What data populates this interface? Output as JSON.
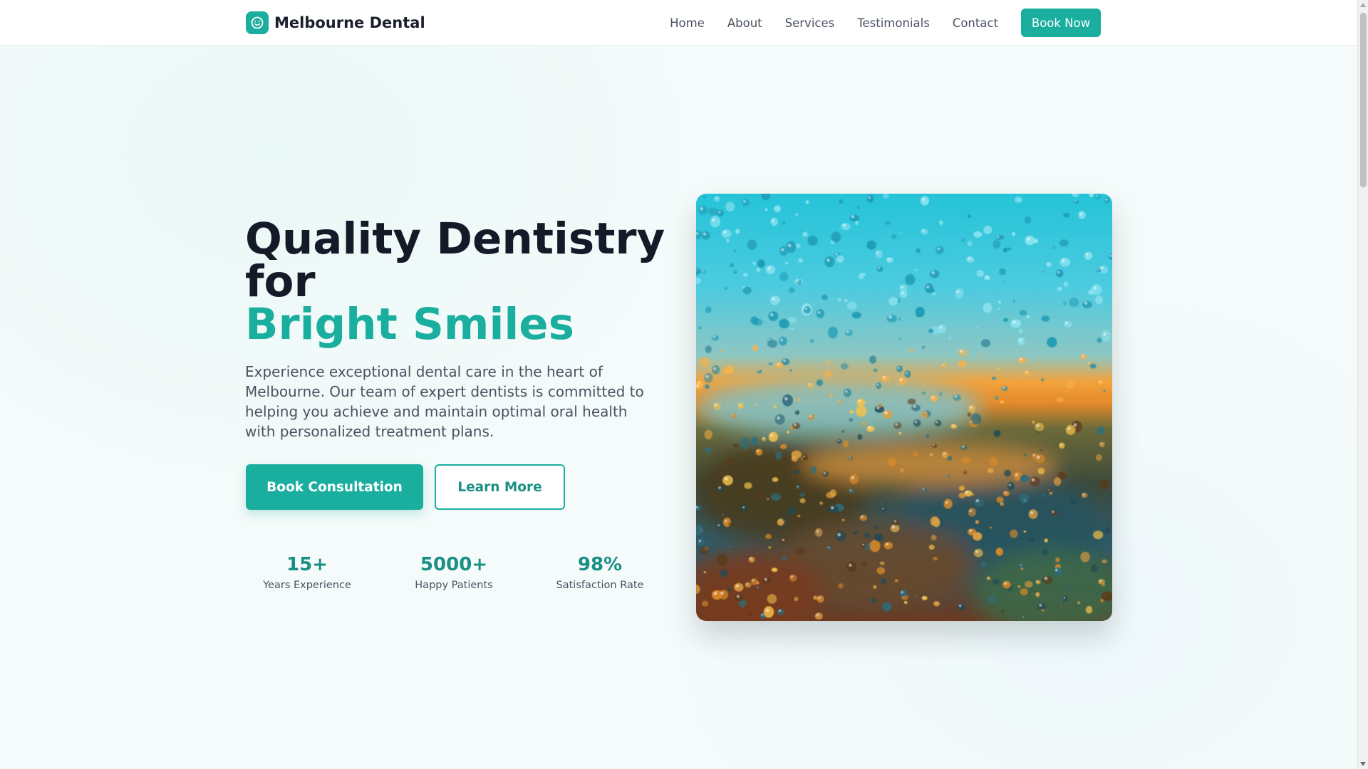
{
  "brand": {
    "name": "Melbourne Dental",
    "accent_color": "#1aae9f",
    "logo_icon": "smile-icon"
  },
  "nav": {
    "items": [
      {
        "label": "Home"
      },
      {
        "label": "About"
      },
      {
        "label": "Services"
      },
      {
        "label": "Testimonials"
      },
      {
        "label": "Contact"
      }
    ],
    "cta_label": "Book Now"
  },
  "hero": {
    "title_line1": "Quality Dentistry for",
    "title_accent": "Bright Smiles",
    "description": "Experience exceptional dental care in the heart of Melbourne. Our team of expert dentists is committed to helping you achieve and maintain optimal oral health with personalized treatment plans.",
    "primary_button": "Book Consultation",
    "secondary_button": "Learn More",
    "stats": [
      {
        "value": "15+",
        "label": "Years Experience"
      },
      {
        "value": "5000+",
        "label": "Happy Patients"
      },
      {
        "value": "98%",
        "label": "Satisfaction Rate"
      }
    ],
    "image_icon": "rain-window-photo"
  }
}
